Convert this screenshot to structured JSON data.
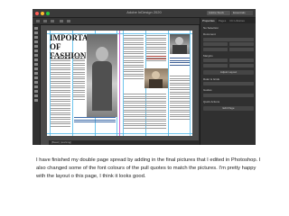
{
  "window": {
    "title": "Adobe InDesign 2020",
    "search_label": "Adobe Stock",
    "workspace_label": "Essentials"
  },
  "colors": {
    "mac_close": "#ff5f57",
    "mac_min": "#febc2e",
    "mac_max": "#28c840",
    "guide": "#49b6e8",
    "spine": "#d066d0"
  },
  "document": {
    "spread_title": "IMPORTANCE OF FASHION"
  },
  "status": {
    "page": "[Basic] (working)"
  },
  "panel": {
    "tabs": [
      "Properties",
      "Pages",
      "CC Libraries"
    ],
    "sections": [
      "No Selection",
      "Document",
      "Margins",
      "Ruler & Grids",
      "Guides",
      "Quick Actions"
    ],
    "buttons": [
      "Adjust Layout",
      "Edit Page"
    ]
  },
  "caption": {
    "paragraph": "I have finished my double page spread by adding in the final pictures that I edited in Photoshop. I also changed some of the font colours of the pull quotes to match the pictures. I'm pretty happy with the layout o this page, I think it looks good."
  }
}
